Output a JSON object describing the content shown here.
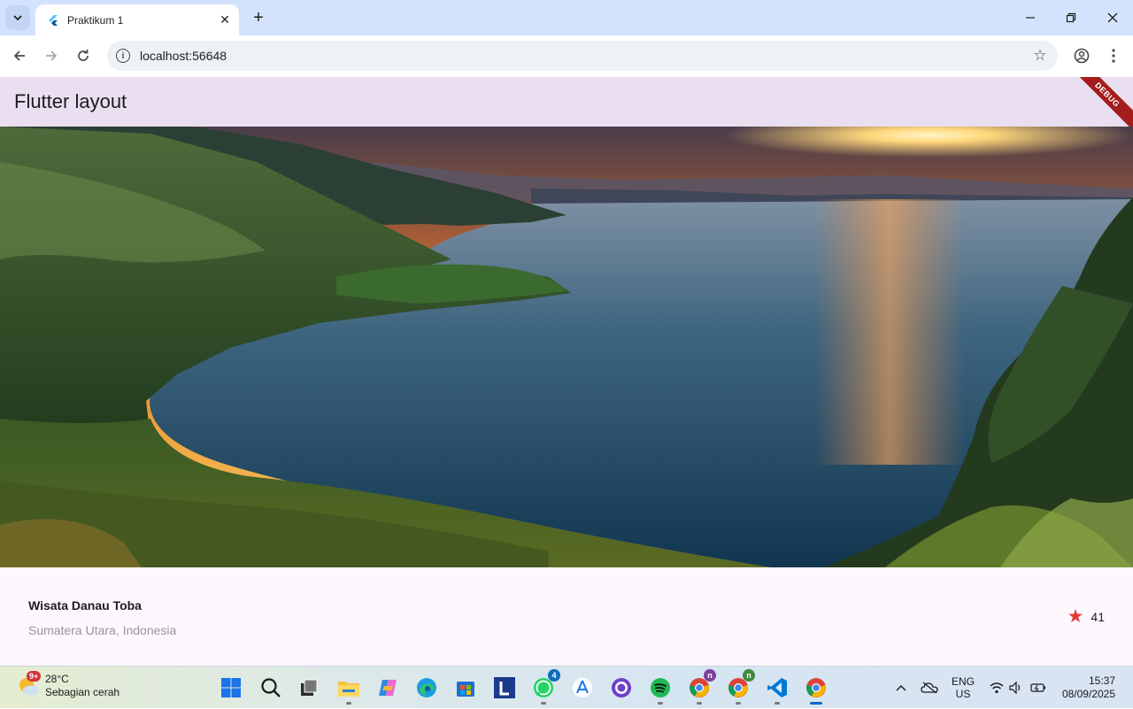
{
  "browser": {
    "tab_title": "Praktikum 1",
    "url": "localhost:56648"
  },
  "app": {
    "title": "Flutter layout",
    "debug_banner": "DEBUG"
  },
  "place": {
    "name": "Wisata Danau Toba",
    "location": "Sumatera Utara, Indonesia",
    "rating_count": "41"
  },
  "taskbar": {
    "weather_badge": "9+",
    "temperature": "28°C",
    "condition": "Sebagian cerah",
    "whatsapp_badge": "4",
    "chrome1_badge": "n",
    "chrome2_badge": "n",
    "lang_primary": "ENG",
    "lang_secondary": "US",
    "time": "15:37",
    "date": "08/09/2025",
    "icons": [
      "windows-start",
      "search",
      "task-view",
      "file-explorer",
      "copilot",
      "edge",
      "microsoft-store",
      "l-app",
      "whatsapp",
      "app-store-like",
      "github-desktop",
      "spotify",
      "chrome-profile-1",
      "chrome-profile-2",
      "vscode",
      "chrome"
    ]
  },
  "colors": {
    "tabstrip": "#d3e3fd",
    "appbar": "#eadff0",
    "info_bg": "#fdf7fe",
    "star": "#e53935",
    "debug": "#a41d1d"
  }
}
